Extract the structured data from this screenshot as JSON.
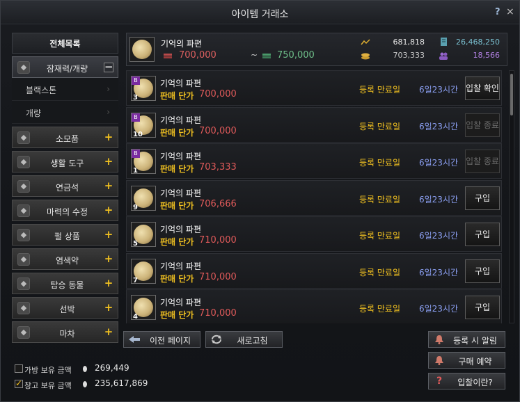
{
  "window": {
    "title": "아이템 거래소",
    "help_label": "?",
    "close_label": "×"
  },
  "sidebar": {
    "header": "전체목록",
    "categories": [
      {
        "label": "잠재력/개량",
        "icon": "potential-icon",
        "expanded": true,
        "sub": [
          "블랙스톤",
          "개량"
        ]
      },
      {
        "label": "소모품",
        "icon": "potion-icon"
      },
      {
        "label": "생활 도구",
        "icon": "tools-icon"
      },
      {
        "label": "연금석",
        "icon": "alchemy-stone-icon"
      },
      {
        "label": "마력의 수정",
        "icon": "crystal-icon"
      },
      {
        "label": "펄 상품",
        "icon": "pearl-icon"
      },
      {
        "label": "염색약",
        "icon": "dye-icon"
      },
      {
        "label": "탑승 동물",
        "icon": "mount-icon"
      },
      {
        "label": "선박",
        "icon": "ship-icon"
      },
      {
        "label": "마차",
        "icon": "wagon-icon"
      }
    ],
    "expand_symbol": "+",
    "collapse_symbol": "−"
  },
  "wallet": {
    "inventory_label": "가방 보유 금액",
    "inventory_value": "269,449",
    "inventory_checked": false,
    "warehouse_label": "창고 보유 금액",
    "warehouse_value": "235,617,869",
    "warehouse_checked": true
  },
  "summary": {
    "item_name": "기억의 파편",
    "min_price": "700,000",
    "tilde": "~",
    "max_price": "750,000",
    "recent_price": "681,818",
    "avg_price": "703,333",
    "total_trades": "26,468,250",
    "registered": "18,566"
  },
  "listings": {
    "price_label": "판매 단가",
    "expire_label": "등록 만료일",
    "rows": [
      {
        "name": "기억의 파편",
        "count": "3",
        "bid": true,
        "price": "700,000",
        "left": "6일23시간",
        "action": "입찰 확인",
        "enabled": true
      },
      {
        "name": "기억의 파편",
        "count": "10",
        "bid": true,
        "price": "700,000",
        "left": "6일23시간",
        "action": "입찰 종료",
        "enabled": false
      },
      {
        "name": "기억의 파편",
        "count": "1",
        "bid": true,
        "price": "703,333",
        "left": "6일23시간",
        "action": "입찰 종료",
        "enabled": false
      },
      {
        "name": "기억의 파편",
        "count": "9",
        "bid": false,
        "price": "706,666",
        "left": "6일23시간",
        "action": "구입",
        "enabled": true
      },
      {
        "name": "기억의 파편",
        "count": "5",
        "bid": false,
        "price": "710,000",
        "left": "6일23시간",
        "action": "구입",
        "enabled": true
      },
      {
        "name": "기억의 파편",
        "count": "7",
        "bid": false,
        "price": "710,000",
        "left": "6일23시간",
        "action": "구입",
        "enabled": true
      },
      {
        "name": "기억의 파편",
        "count": "4",
        "bid": false,
        "price": "710,000",
        "left": "6일23시간",
        "action": "구입",
        "enabled": true
      }
    ],
    "bid_badge": "B"
  },
  "buttons": {
    "prev_page": "이전 페이지",
    "refresh": "새로고침",
    "alert": "등록 시 알림",
    "reserve": "구매 예약",
    "what_is_bid": "입찰이란?"
  },
  "colors": {
    "accent": "#f0c020",
    "price": "#e05a5a",
    "time": "#8a9ef0",
    "max": "#6fc08a"
  }
}
